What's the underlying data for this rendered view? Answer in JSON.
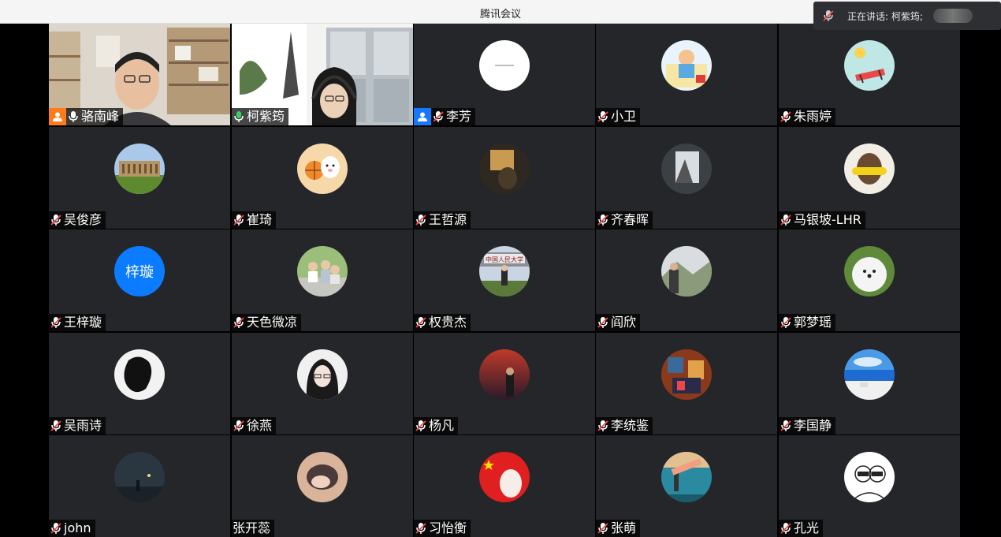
{
  "window": {
    "title": "腾讯会议"
  },
  "speaking": {
    "label": "正在讲话: 柯紫筠;"
  },
  "participants": [
    {
      "name": "骆南峰",
      "mic": "on",
      "badge": "host",
      "media": "video1"
    },
    {
      "name": "柯紫筠",
      "mic": "on-active",
      "badge": "",
      "media": "video2"
    },
    {
      "name": "李芳",
      "mic": "off",
      "badge": "cohost",
      "media": "avatar-white"
    },
    {
      "name": "小卫",
      "mic": "off",
      "badge": "",
      "media": "avatar-cartoon"
    },
    {
      "name": "朱雨婷",
      "mic": "off",
      "badge": "",
      "media": "avatar-beach"
    },
    {
      "name": "吴俊彦",
      "mic": "off",
      "badge": "",
      "media": "avatar-building"
    },
    {
      "name": "崔琦",
      "mic": "off",
      "badge": "",
      "media": "avatar-basketball"
    },
    {
      "name": "王哲源",
      "mic": "off",
      "badge": "",
      "media": "avatar-dark"
    },
    {
      "name": "齐春晖",
      "mic": "off",
      "badge": "",
      "media": "avatar-window"
    },
    {
      "name": "马银坡-LHR",
      "mic": "off",
      "badge": "",
      "media": "avatar-corn"
    },
    {
      "name": "王梓璇",
      "mic": "off",
      "badge": "",
      "media": "avatar-text",
      "avatar_text": "梓璇"
    },
    {
      "name": "天色微凉",
      "mic": "off",
      "badge": "",
      "media": "avatar-group"
    },
    {
      "name": "权贵杰",
      "mic": "off",
      "badge": "",
      "media": "avatar-gate"
    },
    {
      "name": "阎欣",
      "mic": "off",
      "badge": "",
      "media": "avatar-mountain"
    },
    {
      "name": "郭梦瑶",
      "mic": "off",
      "badge": "",
      "media": "avatar-dog"
    },
    {
      "name": "吴雨诗",
      "mic": "off",
      "badge": "",
      "media": "avatar-shadow"
    },
    {
      "name": "徐燕",
      "mic": "off",
      "badge": "",
      "media": "avatar-girl"
    },
    {
      "name": "杨凡",
      "mic": "off",
      "badge": "",
      "media": "avatar-sunset"
    },
    {
      "name": "李统鉴",
      "mic": "off",
      "badge": "",
      "media": "avatar-painting"
    },
    {
      "name": "李国静",
      "mic": "off",
      "badge": "",
      "media": "avatar-sea"
    },
    {
      "name": "john",
      "mic": "off",
      "badge": "",
      "media": "avatar-night"
    },
    {
      "name": "张开蕊",
      "mic": "none",
      "badge": "",
      "media": "avatar-sleeping"
    },
    {
      "name": "习怡衡",
      "mic": "off",
      "badge": "",
      "media": "avatar-flag"
    },
    {
      "name": "张萌",
      "mic": "off",
      "badge": "",
      "media": "avatar-gym"
    },
    {
      "name": "孔光",
      "mic": "off",
      "badge": "",
      "media": "avatar-sketch"
    }
  ]
}
